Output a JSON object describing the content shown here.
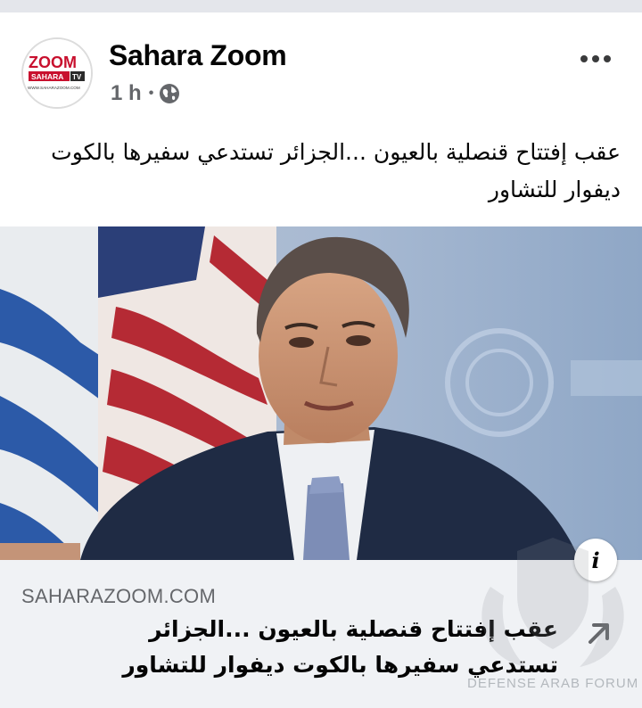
{
  "post": {
    "page_name": "Sahara Zoom",
    "time": "1 h",
    "separator": "•",
    "privacy_icon": "globe-icon",
    "more_icon": "more-options-icon",
    "text": "عقب إفتتاح قنصلية بالعيون ...الجزائر تستدعي سفيرها بالكوت ديفوار للتشاور"
  },
  "avatar": {
    "logo_text_top": "ZOOM",
    "logo_text_sahara": "SAHARA",
    "logo_text_tv": "TV",
    "logo_url": "WWW.SAHARAZOOM.COM"
  },
  "link_preview": {
    "domain": "SAHARAZOOM.COM",
    "title": "عقب إفتتاح قنصلية بالعيون ...الجزائر تستدعي سفيرها بالكوت ديفوار للتشاور",
    "info_label": "i",
    "arrow_icon": "external-link-arrow-icon"
  },
  "watermark": {
    "text": "DEFENSE ARAB FORUM"
  },
  "colors": {
    "brand_red": "#c8102e",
    "text_primary": "#050505",
    "text_secondary": "#65676b",
    "link_background": "#f0f2f5"
  }
}
